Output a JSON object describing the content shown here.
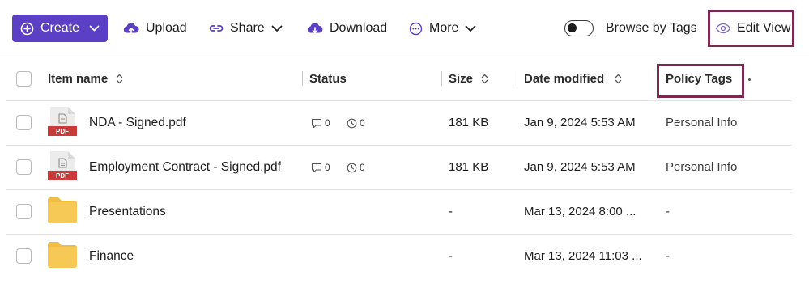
{
  "toolbar": {
    "create_label": "Create",
    "upload_label": "Upload",
    "share_label": "Share",
    "download_label": "Download",
    "more_label": "More",
    "browse_by_tags_label": "Browse by Tags",
    "browse_by_tags_on": false,
    "edit_view_label": "Edit View"
  },
  "table": {
    "columns": {
      "item_name": "Item name",
      "status": "Status",
      "size": "Size",
      "date_modified": "Date modified",
      "policy_tags": "Policy Tags"
    },
    "rows": [
      {
        "icon": "pdf-file-icon",
        "icon_badge": "PDF",
        "name": "NDA - Signed.pdf",
        "comments": "0",
        "tasks": "0",
        "size": "181 KB",
        "date_modified": "Jan 9, 2024 5:53 AM",
        "policy_tags": "Personal Info"
      },
      {
        "icon": "pdf-file-icon",
        "icon_badge": "PDF",
        "name": "Employment Contract - Signed.pdf",
        "comments": "0",
        "tasks": "0",
        "size": "181 KB",
        "date_modified": "Jan 9, 2024 5:53 AM",
        "policy_tags": "Personal Info"
      },
      {
        "icon": "folder-icon",
        "name": "Presentations",
        "size": "-",
        "date_modified": "Mar 13, 2024 8:00 ...",
        "policy_tags": "-"
      },
      {
        "icon": "folder-icon",
        "name": "Finance",
        "size": "-",
        "date_modified": "Mar 13, 2024 11:03 ...",
        "policy_tags": "-"
      }
    ]
  },
  "colors": {
    "accent": "#5b3fc4",
    "highlight_border": "#7b2950",
    "pdf_badge": "#c93a3a",
    "folder": "#f6c957"
  }
}
